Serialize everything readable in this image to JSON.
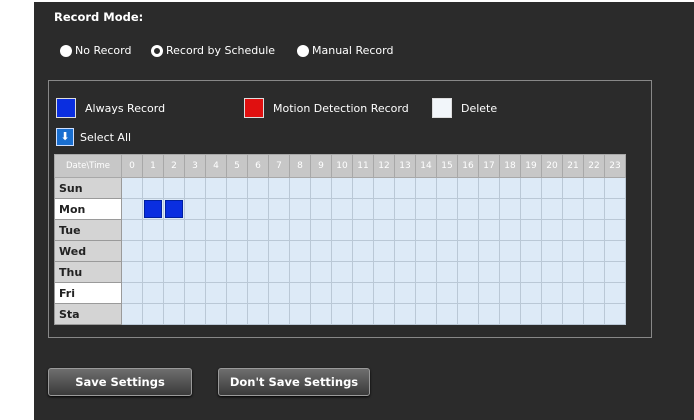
{
  "record_mode": {
    "title": "Record Mode:",
    "options": [
      {
        "label": "No Record",
        "selected": false
      },
      {
        "label": "Record by Schedule",
        "selected": true
      },
      {
        "label": "Manual Record",
        "selected": false
      }
    ]
  },
  "legend": {
    "always_record": "Always Record",
    "motion_detection": "Motion Detection Record",
    "delete": "Delete",
    "select_all": "Select All",
    "colors": {
      "always_record": "#0a2ee0",
      "motion_detection": "#e01010",
      "delete": "#f2f6fa"
    }
  },
  "schedule": {
    "corner_label": "Date\\Time",
    "hours": [
      "0",
      "1",
      "2",
      "3",
      "4",
      "5",
      "6",
      "7",
      "8",
      "9",
      "10",
      "11",
      "12",
      "13",
      "14",
      "15",
      "16",
      "17",
      "18",
      "19",
      "20",
      "21",
      "22",
      "23"
    ],
    "days": [
      {
        "label": "Sun",
        "always_record_hours": []
      },
      {
        "label": "Mon",
        "always_record_hours": [
          1,
          2
        ]
      },
      {
        "label": "Tue",
        "always_record_hours": []
      },
      {
        "label": "Wed",
        "always_record_hours": []
      },
      {
        "label": "Thu",
        "always_record_hours": []
      },
      {
        "label": "Fri",
        "always_record_hours": []
      },
      {
        "label": "Sta",
        "always_record_hours": []
      }
    ]
  },
  "buttons": {
    "save": "Save Settings",
    "dont_save": "Don't Save Settings"
  }
}
